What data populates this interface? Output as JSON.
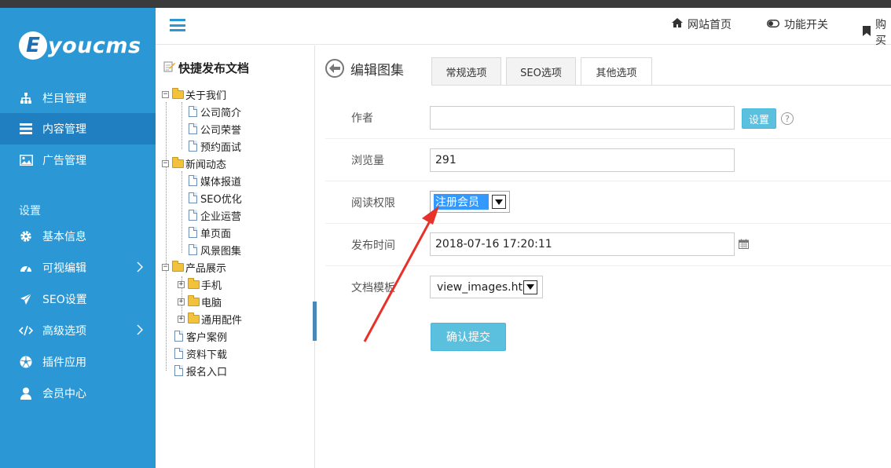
{
  "sidebar": {
    "logo_letter": "E",
    "logo_text": "youcms",
    "section_label": "设置",
    "items": [
      {
        "label": "栏目管理",
        "icon": "sitemap-icon"
      },
      {
        "label": "内容管理",
        "icon": "list-icon",
        "active": true
      },
      {
        "label": "广告管理",
        "icon": "image-icon"
      },
      {
        "label": "基本信息",
        "icon": "gear-icon"
      },
      {
        "label": "可视编辑",
        "icon": "dashboard-icon",
        "has_submenu": true
      },
      {
        "label": "SEO设置",
        "icon": "paper-plane-icon"
      },
      {
        "label": "高级选项",
        "icon": "code-icon",
        "has_submenu": true
      },
      {
        "label": "插件应用",
        "icon": "soccer-ball-icon"
      },
      {
        "label": "会员中心",
        "icon": "user-icon"
      }
    ]
  },
  "header": {
    "links": [
      {
        "label": "网站首页",
        "icon": "home-icon"
      },
      {
        "label": "功能开关",
        "icon": "toggle-icon"
      },
      {
        "label": "购买",
        "icon": "bookmark-icon"
      }
    ]
  },
  "tree": {
    "title": "快捷发布文档",
    "nodes": [
      {
        "label": "关于我们",
        "type": "folder",
        "expanded": true
      },
      {
        "label": "公司简介",
        "type": "doc"
      },
      {
        "label": "公司荣誉",
        "type": "doc"
      },
      {
        "label": "预约面试",
        "type": "doc"
      },
      {
        "label": "新闻动态",
        "type": "folder",
        "expanded": true
      },
      {
        "label": "媒体报道",
        "type": "doc"
      },
      {
        "label": "SEO优化",
        "type": "doc"
      },
      {
        "label": "企业运营",
        "type": "doc"
      },
      {
        "label": "单页面",
        "type": "doc"
      },
      {
        "label": "风景图集",
        "type": "doc"
      },
      {
        "label": "产品展示",
        "type": "folder",
        "expanded": true
      },
      {
        "label": "手机",
        "type": "folder",
        "expanded": false
      },
      {
        "label": "电脑",
        "type": "folder",
        "expanded": false
      },
      {
        "label": "通用配件",
        "type": "folder",
        "expanded": false
      },
      {
        "label": "客户案例",
        "type": "doc"
      },
      {
        "label": "资料下载",
        "type": "doc"
      },
      {
        "label": "报名入口",
        "type": "doc"
      }
    ]
  },
  "main": {
    "title": "编辑图集",
    "tabs": [
      {
        "label": "常规选项"
      },
      {
        "label": "SEO选项"
      },
      {
        "label": "其他选项",
        "active": true
      }
    ],
    "form": {
      "author_label": "作者",
      "author_value": "",
      "author_button": "设置",
      "views_label": "浏览量",
      "views_value": "291",
      "permission_label": "阅读权限",
      "permission_value": "注册会员",
      "publish_label": "发布时间",
      "publish_value": "2018-07-16 17:20:11",
      "template_label": "文档模板",
      "template_value": "view_images.htm",
      "submit_label": "确认提交"
    }
  },
  "colors": {
    "sidebar": "#2b98d5",
    "sidebar_active": "#1f7fc0",
    "button": "#5bc0de",
    "annotation_arrow": "#e8312a",
    "selection": "#3399ff"
  }
}
